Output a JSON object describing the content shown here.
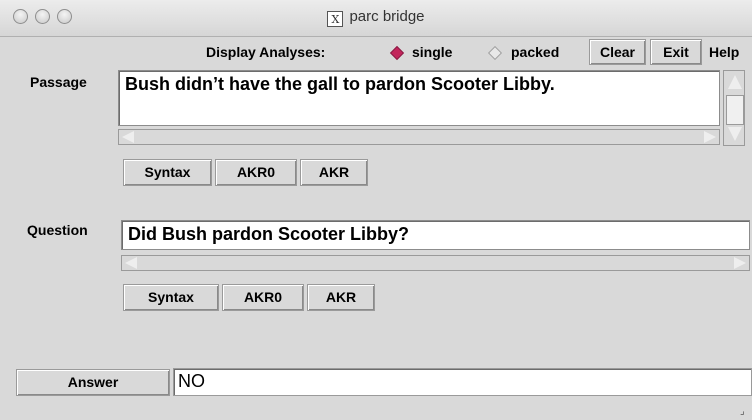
{
  "window": {
    "title": "parc bridge"
  },
  "toolbar": {
    "display_label": "Display Analyses:",
    "option_single": "single",
    "option_packed": "packed",
    "selected": "single",
    "clear_label": "Clear",
    "exit_label": "Exit",
    "help_label": "Help"
  },
  "passage": {
    "label": "Passage",
    "text": "Bush didn’t have the gall to pardon Scooter Libby.",
    "buttons": [
      "Syntax",
      "AKR0",
      "AKR"
    ]
  },
  "question": {
    "label": "Question",
    "text": "Did Bush pardon Scooter Libby?",
    "buttons": [
      "Syntax",
      "AKR0",
      "AKR"
    ]
  },
  "answer": {
    "button_label": "Answer",
    "value": "NO"
  },
  "colors": {
    "accent": "#c3255b",
    "background": "#d9d9d9"
  }
}
